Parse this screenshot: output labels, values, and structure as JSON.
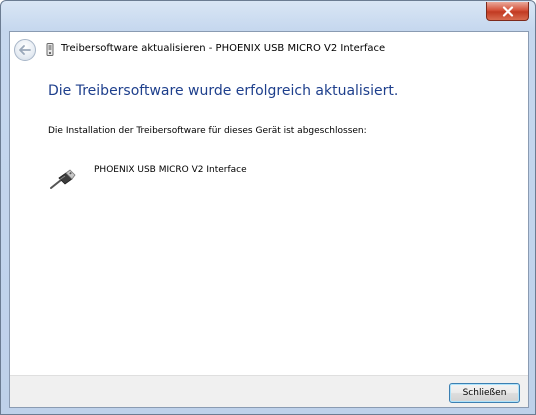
{
  "window": {
    "title": "Treibersoftware aktualisieren - PHOENIX USB MICRO V2 Interface"
  },
  "content": {
    "heading": "Die Treibersoftware wurde erfolgreich aktualisiert.",
    "description": "Die Installation der Treibersoftware für dieses Gerät ist abgeschlossen:",
    "device_name": "PHOENIX USB MICRO V2 Interface"
  },
  "footer": {
    "close_label": "Schließen"
  },
  "icons": {
    "back": "back-arrow-icon",
    "app": "driver-icon",
    "device": "usb-plug-icon",
    "window_close": "close-icon"
  },
  "colors": {
    "heading": "#1e3f8c",
    "close_button_red": "#c13a22",
    "footer_bg": "#f0f0f0"
  }
}
